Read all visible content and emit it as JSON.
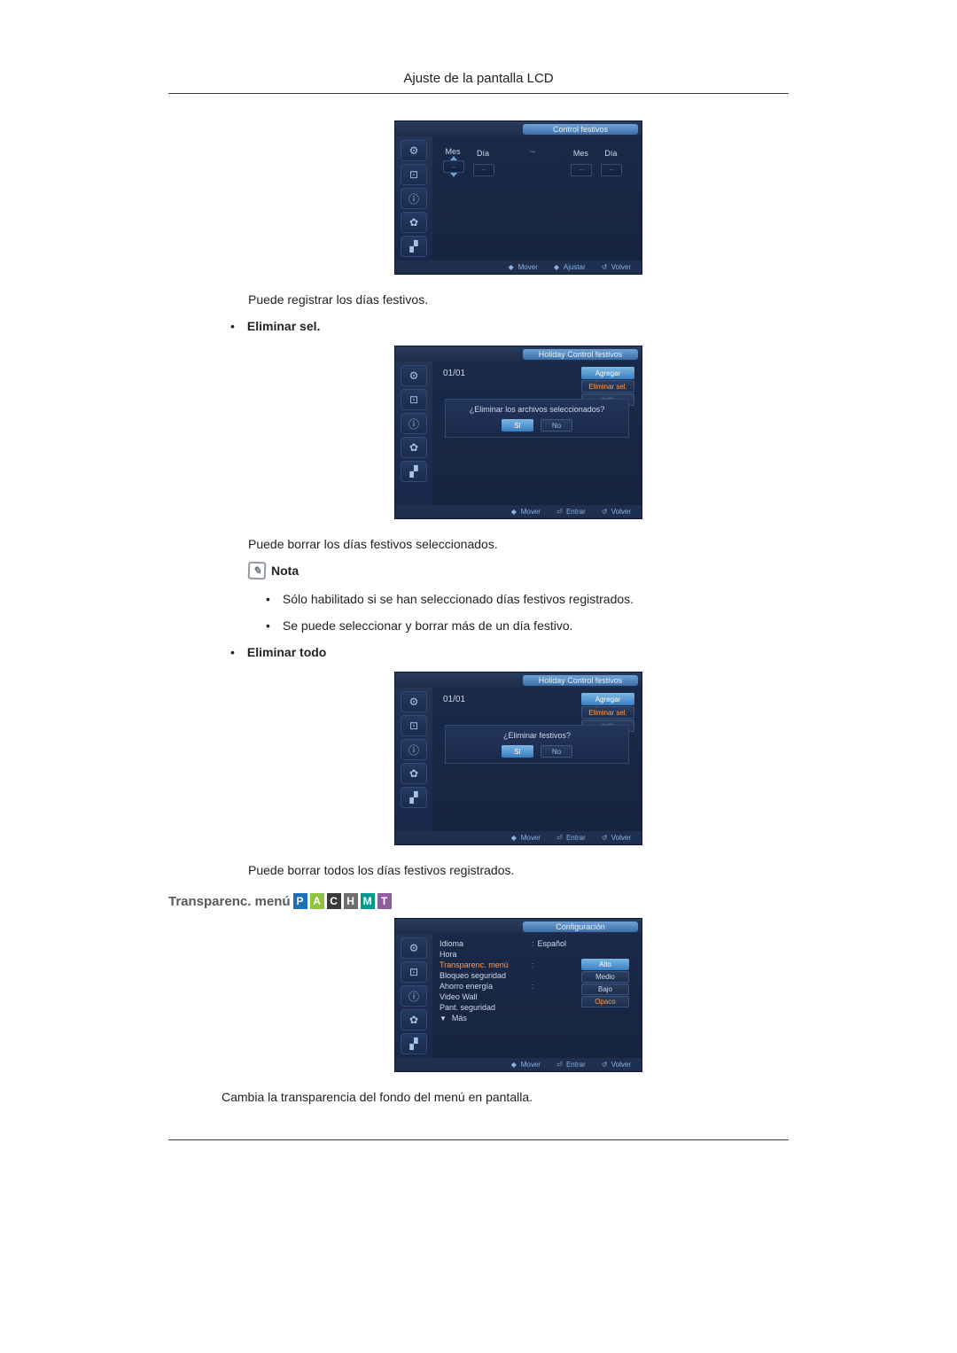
{
  "header": {
    "title": "Ajuste de la pantalla LCD"
  },
  "osd1": {
    "title": "Control festivos",
    "labels": {
      "mes": "Mes",
      "dia": "Día",
      "dash": "--",
      "sep": "~"
    },
    "footer": {
      "mover": "Mover",
      "ajustar": "Ajustar",
      "volver": "Volver"
    }
  },
  "text1": "Puede registrar los días festivos.",
  "bullet1": "Eliminar sel.",
  "osd2": {
    "title": "Holiday Control festivos",
    "date": "01/01",
    "actions": {
      "agregar": "Agregar",
      "eliminar_sel": "Eliminar sel.",
      "todo": "todo"
    },
    "dialog": {
      "msg": "¿Eliminar los archivos seleccionados?",
      "si": "Sí",
      "no": "No"
    },
    "footer": {
      "mover": "Mover",
      "entrar": "Entrar",
      "volver": "Volver"
    }
  },
  "text2": "Puede borrar los días festivos seleccionados.",
  "nota_label": "Nota",
  "nota_items": [
    "Sólo habilitado si se han seleccionado días festivos registrados.",
    "Se puede seleccionar y borrar más de un día festivo."
  ],
  "bullet2": "Eliminar todo",
  "osd3": {
    "title": "Holiday Control festivos",
    "date": "01/01",
    "actions": {
      "agregar": "Agregar",
      "eliminar_sel": "Eliminar sel.",
      "todo": "todo"
    },
    "dialog": {
      "msg": "¿Eliminar festivos?",
      "si": "Sí",
      "no": "No"
    },
    "footer": {
      "mover": "Mover",
      "entrar": "Entrar",
      "volver": "Volver"
    }
  },
  "text3": "Puede borrar todos los días festivos registrados.",
  "section": {
    "title": "Transparenc. menú",
    "badges": [
      "P",
      "A",
      "C",
      "H",
      "M",
      "T"
    ]
  },
  "osd4": {
    "title": "Configuración",
    "rows": {
      "idioma": "Idioma",
      "idioma_val": "Español",
      "hora": "Hora",
      "transp": "Transparenc. menú",
      "bloqueo": "Bloqueo seguridad",
      "ahorro": "Ahorro energía",
      "video": "Video Wall",
      "pant": "Pant. seguridad",
      "mas": "Más"
    },
    "options": {
      "alto": "Alto",
      "medio": "Medio",
      "bajo": "Bajo",
      "opaco": "Opaco"
    },
    "footer": {
      "mover": "Mover",
      "entrar": "Entrar",
      "volver": "Volver"
    }
  },
  "text4": "Cambia la transparencia del fondo del menú en pantalla."
}
